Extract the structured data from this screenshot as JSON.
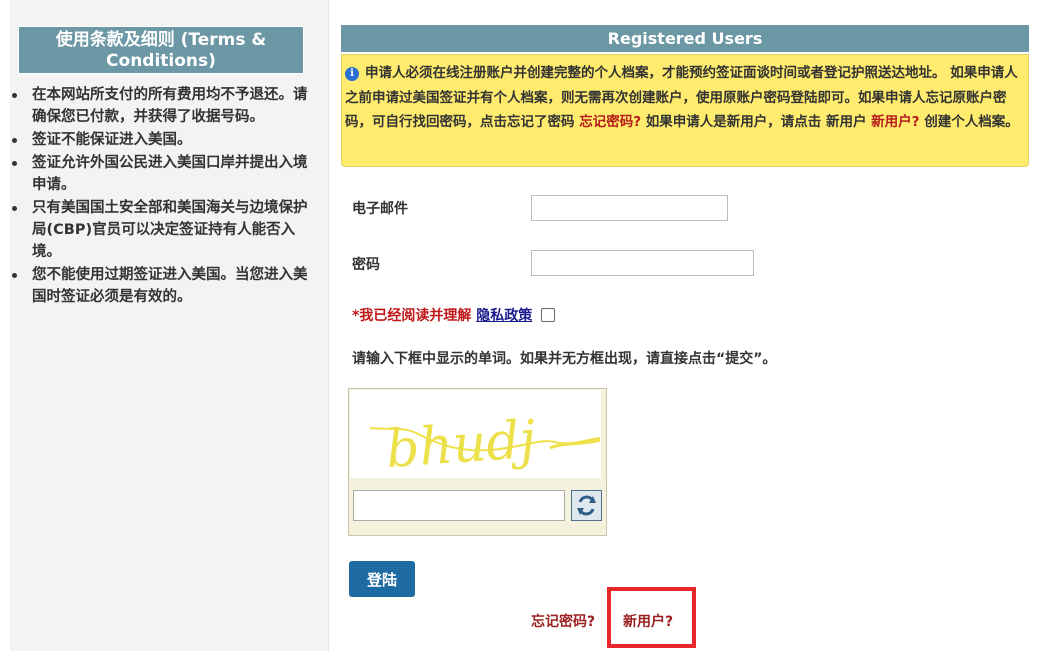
{
  "terms": {
    "header": "使用条款及细则 (Terms & Conditions)",
    "items": [
      "在本网站所支付的所有费用均不予退还。请确保您已付款，并获得了收据号码。",
      "签证不能保证进入美国。",
      "签证允许外国公民进入美国口岸并提出入境申请。",
      "只有美国国土安全部和美国海关与边境保护局(CBP)官员可以决定签证持有人能否入境。",
      "您不能使用过期签证进入美国。当您进入美国时签证必须是有效的。"
    ]
  },
  "login": {
    "header": "Registered Users",
    "notice": {
      "icon": "info-icon",
      "text_part1": "申请人必须在线注册账户并创建完整的个人档案，才能预约签证面谈时间或者登记护照送达地址。 如果申请人之前申请过美国签证并有个人档案，则无需再次创建账户，使用原账户密码登陆即可。如果申请人忘记原账户密码，可自行找回密码，点击忘记了密码",
      "forgot_link": "忘记密码?",
      "text_part2": "如果申请人是新用户，请点击 新用户",
      "new_user_link": "新用户?",
      "text_part3": "创建个人档案。"
    },
    "email_label": "电子邮件",
    "password_label": "密码",
    "agree": {
      "required_text": "*我已经阅读并理解",
      "privacy_link": "隐私政策"
    },
    "captcha_hint": "请输入下框中显示的单词。如果并无方框出现，请直接点击“提交”。",
    "captcha_word": "bhudj",
    "login_button": "登陆",
    "forgot_password": "忘记密码?",
    "new_user": "新用户?"
  },
  "colors": {
    "header_bg": "#6c97a4",
    "notice_bg": "#ffec6e",
    "button_bg": "#1e6ba4",
    "link_red": "#9a1f1f",
    "highlight": "#e8262c"
  }
}
